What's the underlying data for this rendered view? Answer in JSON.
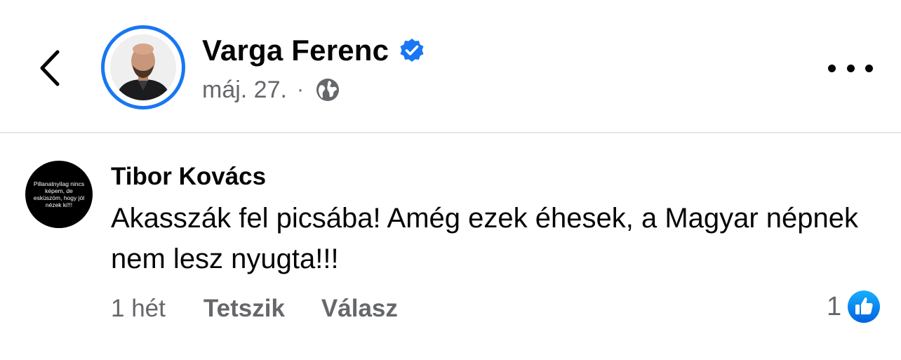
{
  "header": {
    "author_name": "Varga Ferenc",
    "date": "máj. 27.",
    "separator": "·",
    "icons": {
      "back": "chevron-left-icon",
      "verified": "verified-badge-icon",
      "audience": "globe-icon",
      "more": "more-horizontal-icon"
    }
  },
  "comment": {
    "avatar_text": "Pillanatnyilag nincs képem, de esküszöm, hogy jól nézek ki!!!",
    "author": "Tibor Kovács",
    "text": "Akasszák fel picsába! Amég ezek éhesek, a Magyar népnek nem lesz nyugta!!!",
    "time": "1 hét",
    "like_label": "Tetszik",
    "reply_label": "Válasz",
    "reaction_count": "1",
    "reaction_icon": "like-reaction-icon"
  },
  "colors": {
    "accent": "#1877f2",
    "secondary_text": "#65676b",
    "divider": "#e4e6eb"
  }
}
